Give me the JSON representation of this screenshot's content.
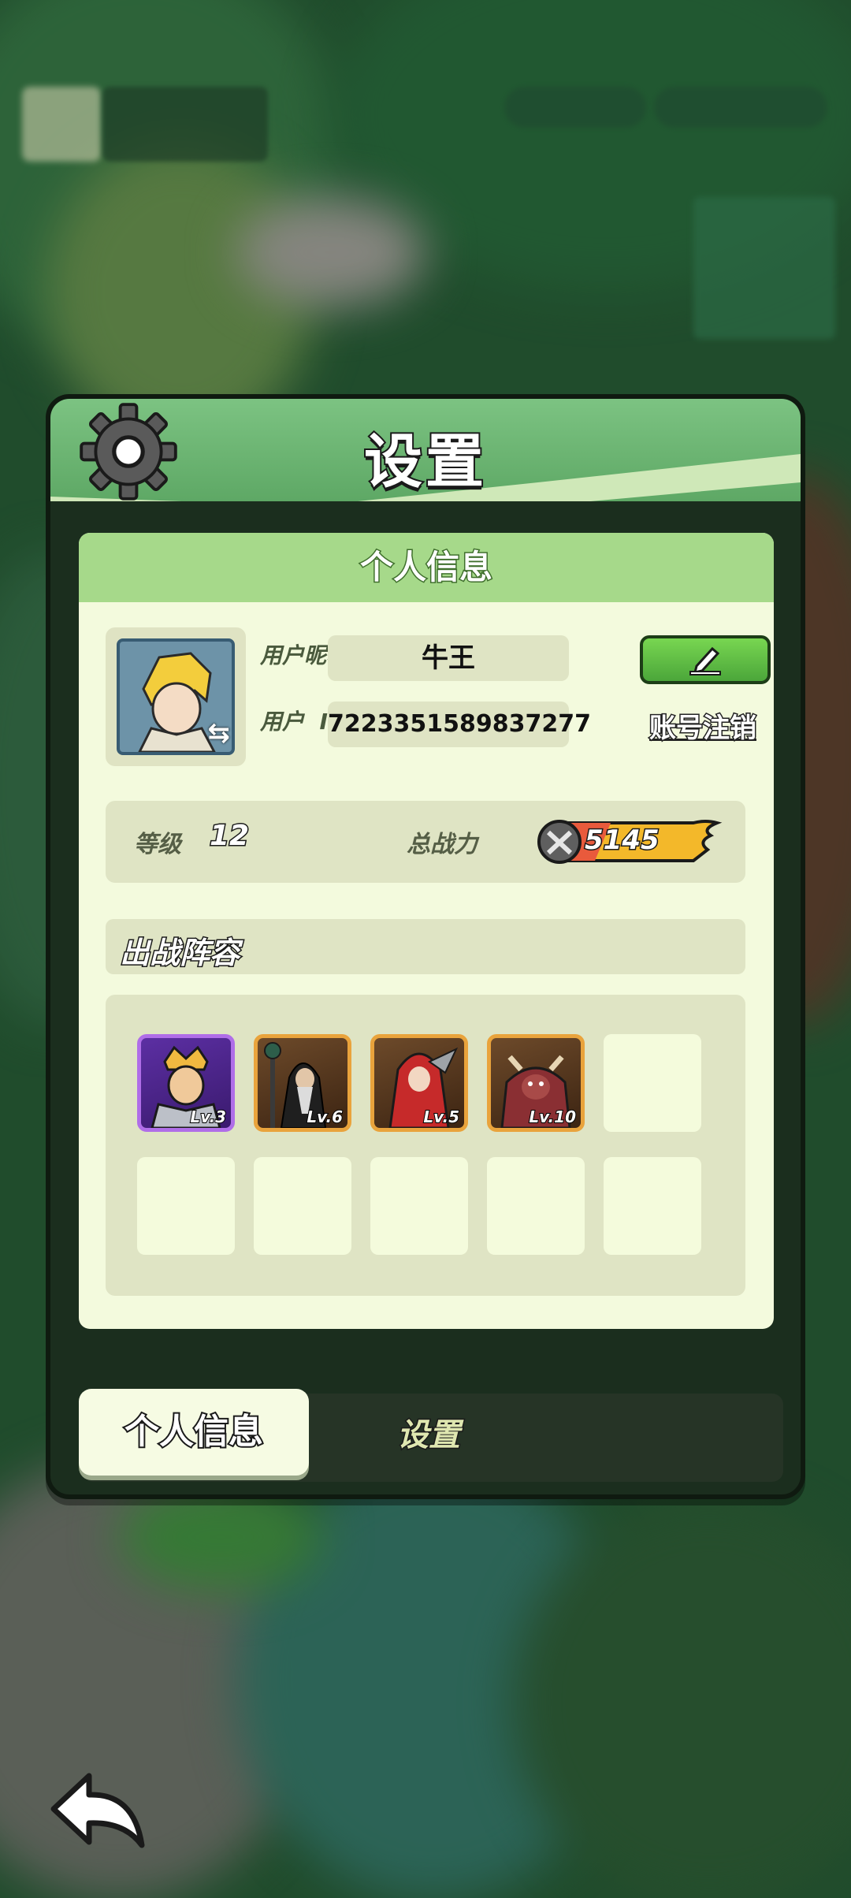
{
  "dialog": {
    "title": "设置",
    "panel_header": "个人信息",
    "profile": {
      "nickname_label": "用户昵称",
      "nickname": "牛王",
      "id_label": "用户  ID",
      "user_id": "7223351589837277",
      "deregister_label": "账号注销",
      "edit_icon": "pencil-icon"
    },
    "stats": {
      "level_label": "等级",
      "level": "12",
      "power_label": "总战力",
      "power": "5145"
    },
    "lineup": {
      "title": "出战阵容",
      "heroes": [
        {
          "level": "Lv.3",
          "rarity": "purple"
        },
        {
          "level": "Lv.6",
          "rarity": "gold"
        },
        {
          "level": "Lv.5",
          "rarity": "gold"
        },
        {
          "level": "Lv.10",
          "rarity": "gold"
        }
      ],
      "empty_slots": 6
    },
    "tabs": [
      {
        "label": "个人信息",
        "active": true
      },
      {
        "label": "设置",
        "active": false
      }
    ]
  },
  "colors": {
    "header_green": "#7cc382",
    "panel_bg": "#f3fadd",
    "edit_green": "#5bbf44",
    "purple_frame": "#b06ee8",
    "gold_frame": "#e9a33c"
  }
}
